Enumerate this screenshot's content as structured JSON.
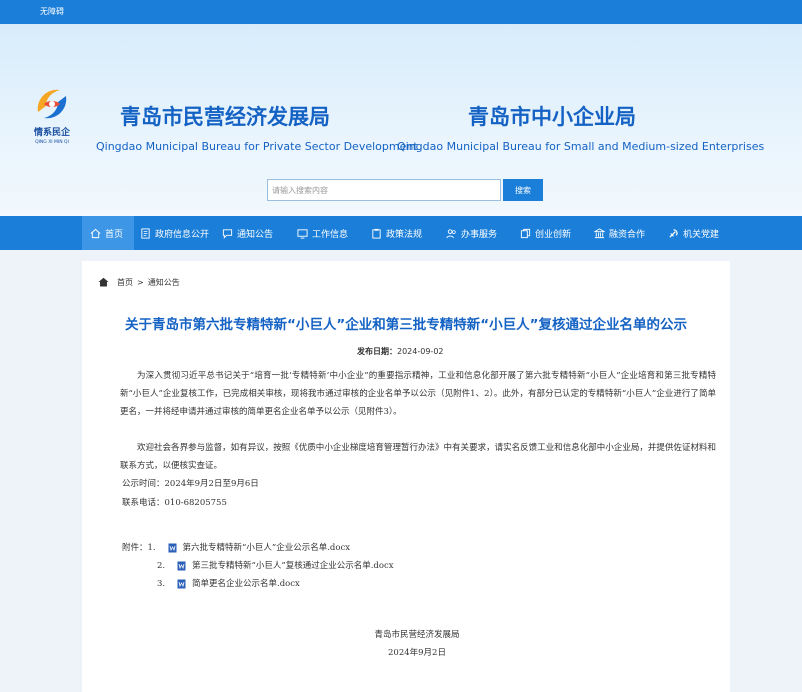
{
  "topbar": {
    "accessibility": "无障碍"
  },
  "header": {
    "logo_cn": "情系民企",
    "logo_en": "QING XI MIN QI",
    "org1_cn": "青岛市民营经济发展局",
    "org1_en": "Qingdao Municipal Bureau for Private Sector Development",
    "org2_cn": "青岛市中小企业局",
    "org2_en": "Qingdao Municipal Bureau for Small and Medium-sized Enterprises"
  },
  "search": {
    "placeholder": "请输入搜索内容",
    "button": "搜索"
  },
  "nav": {
    "items": [
      {
        "label": "首页",
        "icon": "home-icon"
      },
      {
        "label": "政府信息公开",
        "icon": "document-icon"
      },
      {
        "label": "通知公告",
        "icon": "chat-icon"
      },
      {
        "label": "工作信息",
        "icon": "monitor-icon"
      },
      {
        "label": "政策法规",
        "icon": "clipboard-icon"
      },
      {
        "label": "办事服务",
        "icon": "people-icon"
      },
      {
        "label": "创业创新",
        "icon": "copy-icon"
      },
      {
        "label": "融资合作",
        "icon": "bank-icon"
      },
      {
        "label": "机关党建",
        "icon": "party-icon"
      }
    ]
  },
  "breadcrumb": {
    "home": "首页",
    "separator": ">",
    "current": "通知公告"
  },
  "article": {
    "title": "关于青岛市第六批专精特新“小巨人”企业和第三批专精特新“小巨人”复核通过企业名单的公示",
    "date_label": "发布日期：",
    "date": "2024-09-02",
    "para1": "为深入贯彻习近平总书记关于“培育一批‘专精特新’中小企业”的重要指示精神，工业和信息化部开展了第六批专精特新“小巨人”企业培育和第三批专精特新“小巨人”企业复核工作，已完成相关审核，现将我市通过审核的企业名单予以公示（见附件1、2）。此外，有部分已认定的专精特新“小巨人”企业进行了简单更名，一并将经申请并通过审核的简单更名企业名单予以公示（见附件3）。",
    "para2": "欢迎社会各界参与监督，如有异议，按照《优质中小企业梯度培育管理暂行办法》中有关要求，请实名反馈工业和信息化部中小企业局，并提供佐证材料和联系方式，以便核实查证。",
    "period": "公示时间：2024年9月2日至9月6日",
    "phone": "联系电话：010-68205755",
    "attachments_label": "附件：",
    "attachments": [
      {
        "num": "1.",
        "name": "第六批专精特新“小巨人”企业公示名单.docx"
      },
      {
        "num": "2.",
        "name": "第三批专精特新“小巨人”复核通过企业公示名单.docx"
      },
      {
        "num": "3.",
        "name": "简单更名企业公示名单.docx"
      }
    ],
    "sign_org": "青岛市民营经济发展局",
    "sign_date": "2024年9月2日"
  }
}
